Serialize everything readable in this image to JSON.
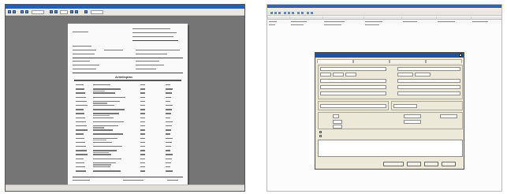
{
  "left_panel": {
    "toolbar": {
      "icons": [
        "print-icon",
        "save-icon",
        "zoom-in-icon",
        "zoom-out-icon",
        "first-page-icon",
        "prev-page-icon",
        "next-page-icon",
        "last-page-icon",
        "close-icon"
      ]
    },
    "document": {
      "section_heading": "Arbeitsplan"
    }
  },
  "right_panel": {
    "toolbar": {
      "icons": [
        "new-icon",
        "open-icon",
        "save-icon",
        "cut-icon",
        "copy-icon",
        "paste-icon",
        "undo-icon",
        "delete-icon",
        "find-icon",
        "print-icon"
      ]
    },
    "dialog": {
      "tab_count": 4,
      "buttons": [
        "",
        "",
        "",
        ""
      ]
    }
  },
  "colors": {
    "preview_background": "#6e6e6e",
    "titlebar_blue": "#1f5fbf",
    "dialog_face": "#ece9d8",
    "dialog_title": "#264f9c"
  }
}
